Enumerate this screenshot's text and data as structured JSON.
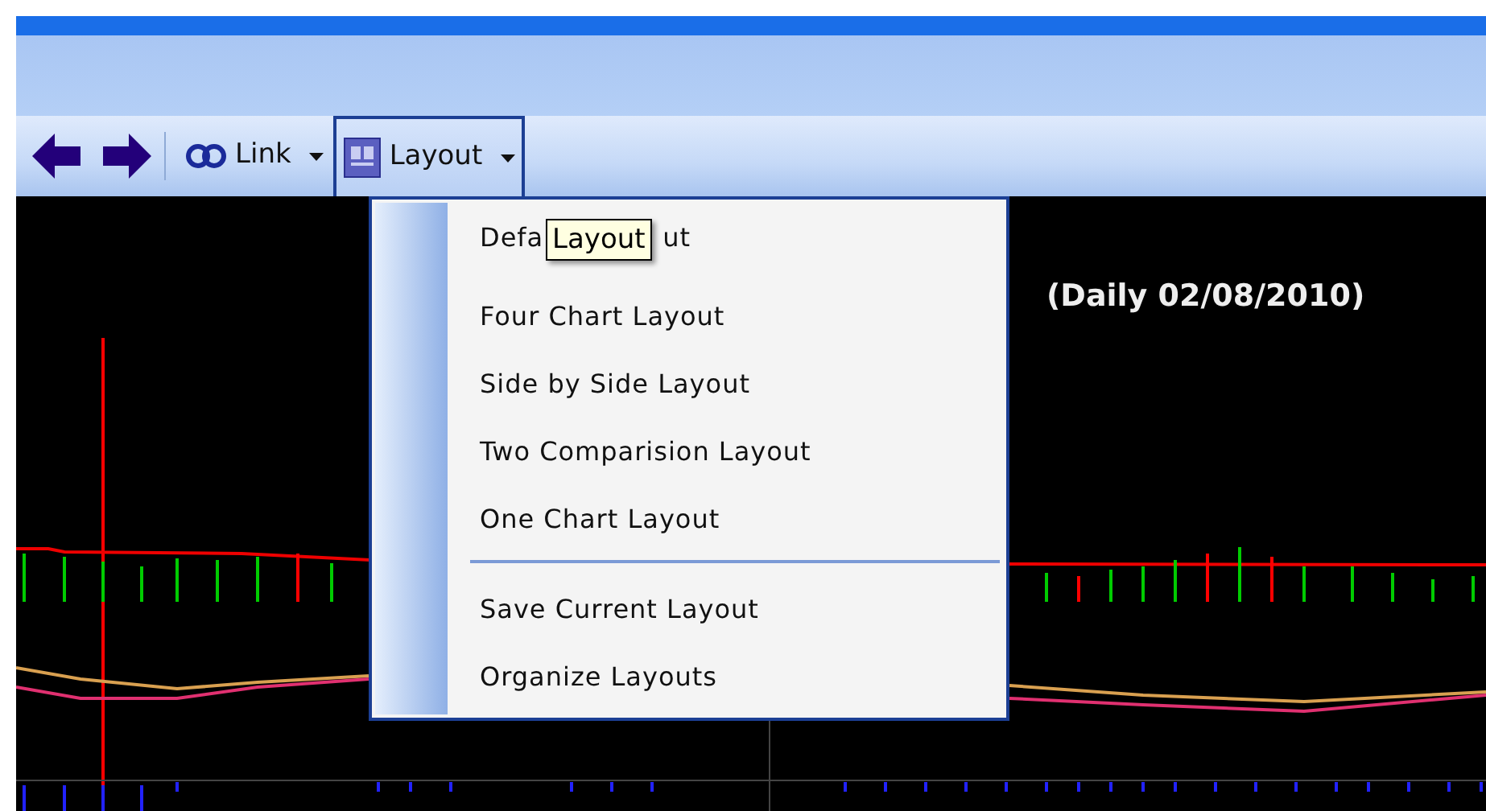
{
  "toolbar": {
    "link": {
      "label": "Link"
    },
    "layout": {
      "label": "Layout",
      "expanded": true
    }
  },
  "menu": {
    "items": [
      {
        "kind": "covered",
        "label_start": "Defa",
        "label_end": "ut"
      },
      {
        "kind": "item",
        "label": "Four Chart Layout"
      },
      {
        "kind": "item",
        "label": "Side by Side Layout"
      },
      {
        "kind": "item",
        "label": "Two Comparision Layout"
      },
      {
        "kind": "item",
        "label": "One Chart Layout"
      },
      {
        "kind": "separator"
      },
      {
        "kind": "item",
        "label": "Save Current Layout"
      },
      {
        "kind": "item",
        "label": "Organize Layouts"
      }
    ]
  },
  "tooltip": {
    "text": "Layout"
  },
  "chart": {
    "title": "(Daily  02/08/2010)"
  }
}
